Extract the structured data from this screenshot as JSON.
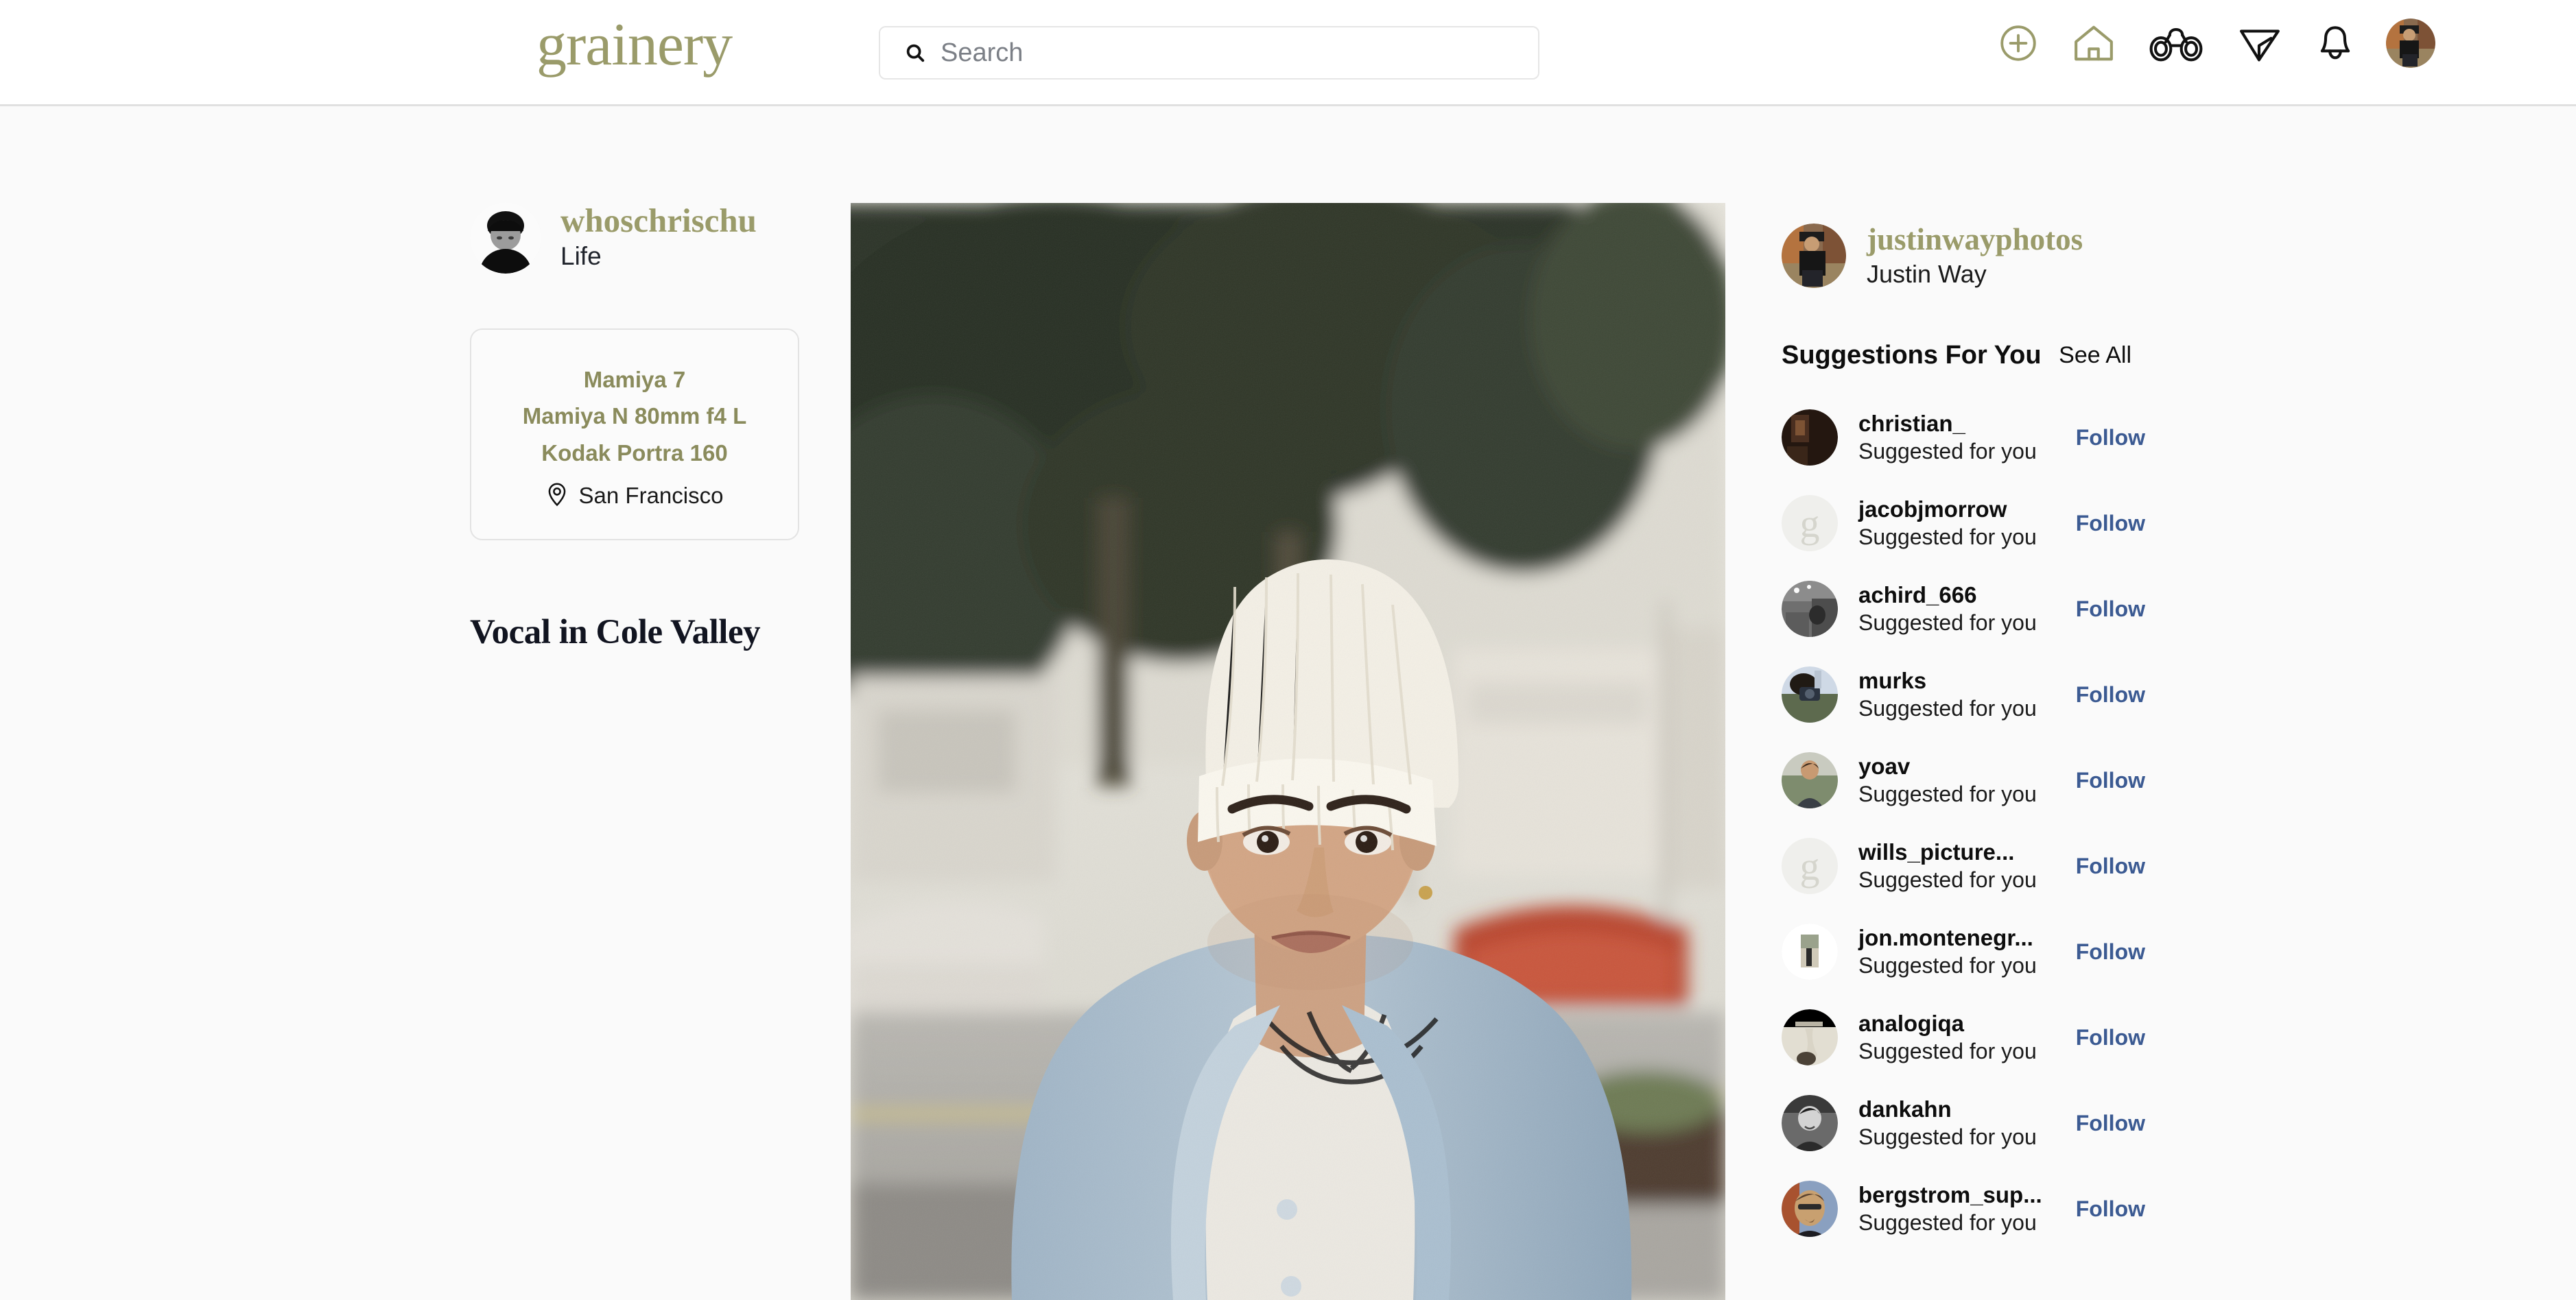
{
  "brand": {
    "logo_text": "grainery",
    "accent_color": "#9a9b6a",
    "olive_text_color": "#8a8b5c",
    "link_color": "#3b5a92"
  },
  "header": {
    "search": {
      "placeholder": "Search",
      "value": "",
      "icon": "search-icon"
    },
    "nav_icons": [
      {
        "name": "add-post-icon",
        "label": "Create"
      },
      {
        "name": "home-icon",
        "label": "Home",
        "active": true
      },
      {
        "name": "explore-binoculars-icon",
        "label": "Explore"
      },
      {
        "name": "direct-send-icon",
        "label": "Messages"
      },
      {
        "name": "notifications-bell-icon",
        "label": "Notifications"
      },
      {
        "name": "profile-avatar-icon",
        "label": "Profile"
      }
    ]
  },
  "post": {
    "author": {
      "username": "whoschrischu",
      "display_name": "Life"
    },
    "gear": {
      "camera": "Mamiya 7",
      "lens": "Mamiya N 80mm f4 L",
      "film": "Kodak Portra 160",
      "location": "San Francisco",
      "location_icon": "location-pin-icon"
    },
    "title": "Vocal in Cole Valley"
  },
  "sidebar": {
    "current_user": {
      "username": "justinwayphotos",
      "full_name": "Justin Way"
    },
    "suggestions_title": "Suggestions For You",
    "see_all_label": "See All",
    "follow_label": "Follow",
    "suggested_subtitle": "Suggested for you",
    "suggestions": [
      {
        "username": "christian_",
        "subtitle": "Suggested for you",
        "action": "Follow",
        "avatar_type": "photo",
        "avatar_color": "#2a1a14"
      },
      {
        "username": "jacobjmorrow",
        "subtitle": "Suggested for you",
        "action": "Follow",
        "avatar_type": "placeholder",
        "avatar_color": "#efefec"
      },
      {
        "username": "achird_666",
        "subtitle": "Suggested for you",
        "action": "Follow",
        "avatar_type": "photo",
        "avatar_color": "#4a4a4a"
      },
      {
        "username": "murks",
        "subtitle": "Suggested for you",
        "action": "Follow",
        "avatar_type": "photo",
        "avatar_color": "#9fb0c4"
      },
      {
        "username": "yoav",
        "subtitle": "Suggested for you",
        "action": "Follow",
        "avatar_type": "photo",
        "avatar_color": "#97a48a"
      },
      {
        "username": "wills_picture...",
        "subtitle": "Suggested for you",
        "action": "Follow",
        "avatar_type": "placeholder",
        "avatar_color": "#efefec"
      },
      {
        "username": "jon.montenegr...",
        "subtitle": "Suggested for you",
        "action": "Follow",
        "avatar_type": "photo-white",
        "avatar_color": "#ffffff"
      },
      {
        "username": "analogiqa",
        "subtitle": "Suggested for you",
        "action": "Follow",
        "avatar_type": "photo",
        "avatar_color": "#d6d2c8"
      },
      {
        "username": "dankahn",
        "subtitle": "Suggested for you",
        "action": "Follow",
        "avatar_type": "photo",
        "avatar_color": "#5a5a5a"
      },
      {
        "username": "bergstrom_sup...",
        "subtitle": "Suggested for you",
        "action": "Follow",
        "avatar_type": "photo",
        "avatar_color": "#7a6a52"
      }
    ]
  }
}
